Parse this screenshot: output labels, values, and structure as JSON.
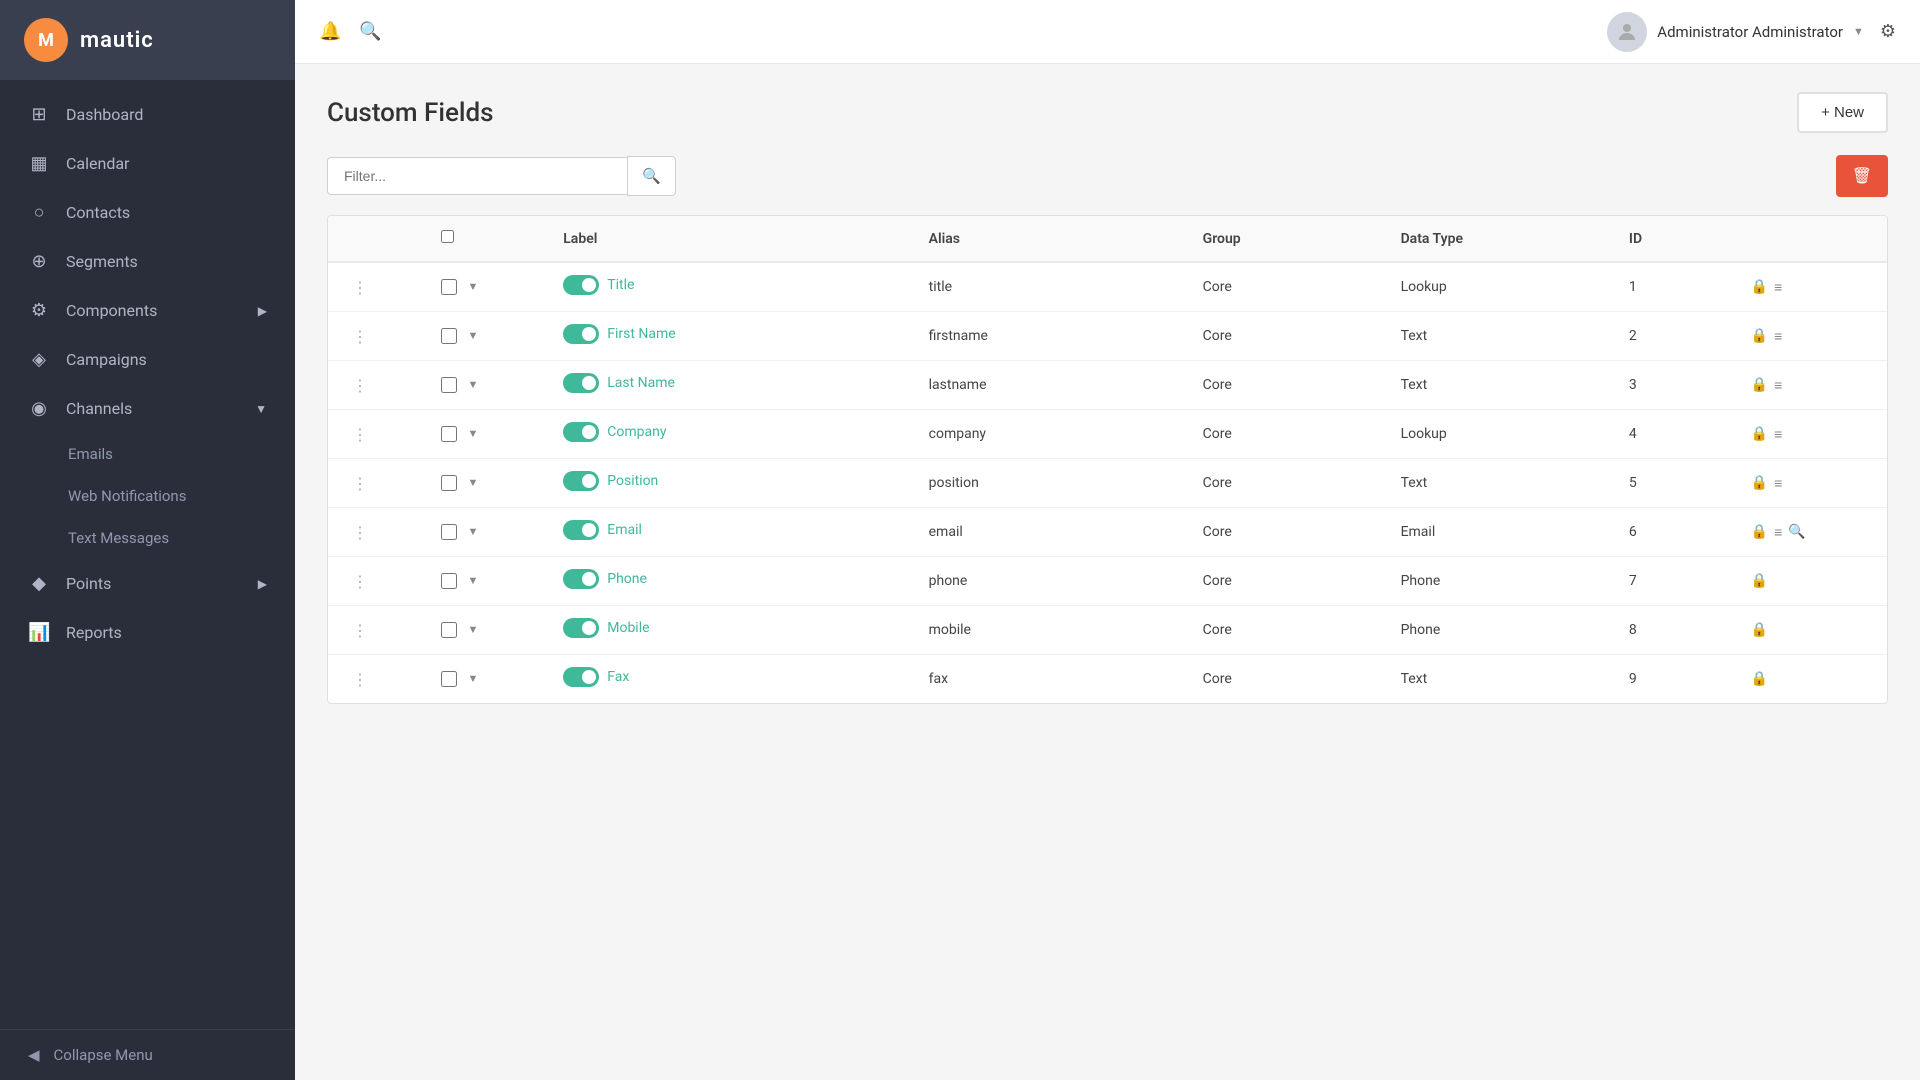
{
  "app": {
    "logo": "M",
    "logo_name": "mautic"
  },
  "sidebar": {
    "items": [
      {
        "id": "dashboard",
        "label": "Dashboard",
        "icon": "⊞",
        "has_sub": false
      },
      {
        "id": "calendar",
        "label": "Calendar",
        "icon": "📅",
        "has_sub": false
      },
      {
        "id": "contacts",
        "label": "Contacts",
        "icon": "👤",
        "has_sub": false
      },
      {
        "id": "segments",
        "label": "Segments",
        "icon": "⊕",
        "has_sub": false
      },
      {
        "id": "components",
        "label": "Components",
        "icon": "⚙",
        "has_sub": true
      },
      {
        "id": "campaigns",
        "label": "Campaigns",
        "icon": "📣",
        "has_sub": false
      },
      {
        "id": "channels",
        "label": "Channels",
        "icon": "📡",
        "has_sub": true
      }
    ],
    "channel_sub_items": [
      {
        "id": "emails",
        "label": "Emails"
      },
      {
        "id": "web-notifications",
        "label": "Web Notifications"
      },
      {
        "id": "text-messages",
        "label": "Text Messages"
      }
    ],
    "bottom_items": [
      {
        "id": "points",
        "label": "Points",
        "icon": "◆",
        "has_sub": true
      },
      {
        "id": "reports",
        "label": "Reports",
        "icon": "📊",
        "has_sub": false
      }
    ],
    "collapse_label": "Collapse Menu"
  },
  "topbar": {
    "bell_icon": "🔔",
    "search_icon": "🔍",
    "user_name": "Administrator Administrator",
    "gear_icon": "⚙"
  },
  "page": {
    "title": "Custom Fields",
    "new_button": "+ New",
    "filter_placeholder": "Filter...",
    "trash_icon": "🗑"
  },
  "table": {
    "columns": [
      "",
      "",
      "Label",
      "Alias",
      "Group",
      "Data Type",
      "ID",
      ""
    ],
    "rows": [
      {
        "id": 1,
        "label": "Title",
        "alias": "title",
        "group": "Core",
        "data_type": "Lookup",
        "toggle_on": true,
        "has_list": true,
        "has_search": false
      },
      {
        "id": 2,
        "label": "First Name",
        "alias": "firstname",
        "group": "Core",
        "data_type": "Text",
        "toggle_on": true,
        "has_list": true,
        "has_search": false
      },
      {
        "id": 3,
        "label": "Last Name",
        "alias": "lastname",
        "group": "Core",
        "data_type": "Text",
        "toggle_on": true,
        "has_list": true,
        "has_search": false
      },
      {
        "id": 4,
        "label": "Company",
        "alias": "company",
        "group": "Core",
        "data_type": "Lookup",
        "toggle_on": true,
        "has_list": true,
        "has_search": false
      },
      {
        "id": 5,
        "label": "Position",
        "alias": "position",
        "group": "Core",
        "data_type": "Text",
        "toggle_on": true,
        "has_list": true,
        "has_search": false
      },
      {
        "id": 6,
        "label": "Email",
        "alias": "email",
        "group": "Core",
        "data_type": "Email",
        "toggle_on": true,
        "has_list": true,
        "has_search": true
      },
      {
        "id": 7,
        "label": "Phone",
        "alias": "phone",
        "group": "Core",
        "data_type": "Phone",
        "toggle_on": true,
        "has_list": false,
        "has_search": false
      },
      {
        "id": 8,
        "label": "Mobile",
        "alias": "mobile",
        "group": "Core",
        "data_type": "Phone",
        "toggle_on": true,
        "has_list": false,
        "has_search": false
      },
      {
        "id": 9,
        "label": "Fax",
        "alias": "fax",
        "group": "Core",
        "data_type": "Text",
        "toggle_on": true,
        "has_list": false,
        "has_search": false
      }
    ]
  }
}
